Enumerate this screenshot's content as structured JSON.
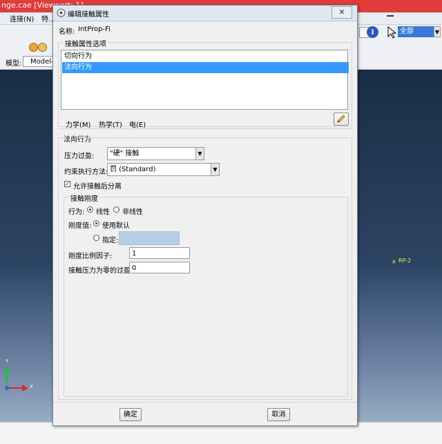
{
  "app": {
    "title": "nge.cae [Viewport: 1]",
    "menus": [
      "连接(N)",
      "特…"
    ],
    "model_label": "模型:",
    "model_value": "Model-",
    "selection_value": "全部",
    "viewport_point_label": "RP-2",
    "triad": {
      "x": "X",
      "y": "Y"
    }
  },
  "dialog": {
    "title": "编辑接触属性",
    "name_label": "名称:",
    "name_value": "IntProp-Fi",
    "options_group_label": "接触属性选项",
    "options": [
      "切向行为",
      "法向行为"
    ],
    "selected_option_index": 1,
    "tabs": [
      "力学(M)",
      "热学(T)",
      "电(E)"
    ],
    "section_title": "法向行为",
    "pressure_overclosure_label": "压力过盈:",
    "pressure_overclosure_value": "\"硬\" 接触",
    "constraint_method_label": "约束执行方法:",
    "constraint_method_value": "罚 (Standard)",
    "allow_separation_label": "允许接触后分离",
    "allow_separation_checked": true,
    "stiffness": {
      "group_label": "接触刚度",
      "behavior_label": "行为:",
      "behavior_options": [
        "线性",
        "非线性"
      ],
      "behavior_selected": "线性",
      "value_label": "刚度值:",
      "value_options": [
        "使用默认",
        "指定:"
      ],
      "value_selected": "使用默认",
      "specify_value": "",
      "scale_factor_label": "刚度比例因子:",
      "scale_factor_value": "1",
      "zero_pressure_label": "接触压力为零的过盈:",
      "zero_pressure_value": "0"
    },
    "ok_label": "确定",
    "cancel_label": "取消"
  },
  "colors": {
    "selection": "#3399ff",
    "app_title_bar": "#e23b3b",
    "specify_field_disabled": "#b7cde6"
  }
}
